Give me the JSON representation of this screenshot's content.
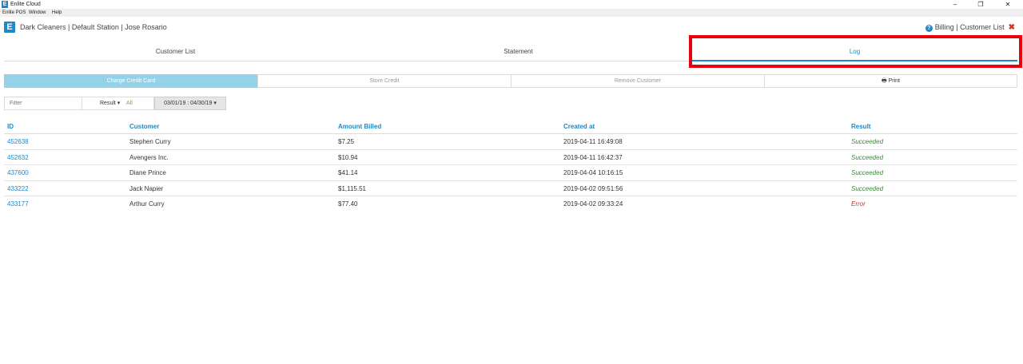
{
  "window": {
    "title": "Enlite Cloud",
    "controls": [
      "–",
      "❐",
      "✕"
    ]
  },
  "menu": [
    "Enlite POS",
    "Window",
    "Help"
  ],
  "header": {
    "logo": "E",
    "store_title": "Dark Cleaners | Default Station | Jose Rosario",
    "help_icon": "?",
    "breadcrumb": "Billing | Customer List",
    "close_icon": "✖"
  },
  "tabs": [
    {
      "label": "Customer List",
      "active": false
    },
    {
      "label": "Statement",
      "active": false
    },
    {
      "label": "Log",
      "active": true
    }
  ],
  "actions": {
    "charge": "Charge Credit Card",
    "store_credit": "Store Credit",
    "remove": "Remove Customer",
    "print": "Print"
  },
  "filters": {
    "filter_placeholder": "Filter",
    "result_label": "Result ▾",
    "result_value": "All",
    "date_range": "03/01/19 : 04/30/19 ▾"
  },
  "table": {
    "columns": [
      "ID",
      "Customer",
      "Amount Billed",
      "Created at",
      "Result"
    ],
    "rows": [
      {
        "id": "452638",
        "customer": "Stephen Curry",
        "amount": "$7.25",
        "created": "2019-04-11 16:49:08",
        "result": "Succeeded"
      },
      {
        "id": "452632",
        "customer": "Avengers Inc.",
        "amount": "$10.94",
        "created": "2019-04-11 16:42:37",
        "result": "Succeeded"
      },
      {
        "id": "437600",
        "customer": "Diane Prince",
        "amount": "$41.14",
        "created": "2019-04-04 10:16:15",
        "result": "Succeeded"
      },
      {
        "id": "433222",
        "customer": "Jack Napier",
        "amount": "$1,115.51",
        "created": "2019-04-02 09:51:56",
        "result": "Succeeded"
      },
      {
        "id": "433177",
        "customer": "Arthur Curry",
        "amount": "$77.40",
        "created": "2019-04-02 09:33:24",
        "result": "Error"
      }
    ]
  },
  "colors": {
    "accent": "#1e88c8",
    "primary_button": "#93d2e8",
    "success": "#3c8a36",
    "error": "#c0392b",
    "highlight": "#e8000b"
  }
}
